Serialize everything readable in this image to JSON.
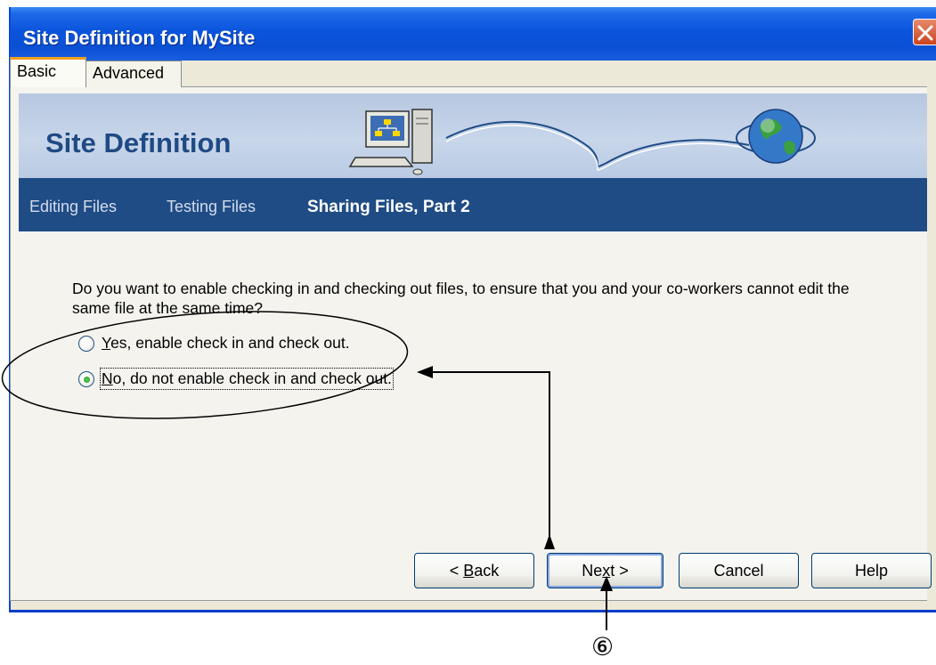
{
  "window": {
    "title": "Site Definition for MySite"
  },
  "tabs": [
    {
      "label": "Basic",
      "selected": true
    },
    {
      "label": "Advanced",
      "selected": false
    }
  ],
  "banner": {
    "title": "Site Definition",
    "icons": [
      "computer-network-icon",
      "globe-icon"
    ]
  },
  "steps": {
    "items": [
      "Editing Files",
      "Testing Files"
    ],
    "current": "Sharing Files, Part 2"
  },
  "content": {
    "question": "Do you want to enable checking in and checking out files, to ensure that you and your co-workers cannot edit the same file at the same time?",
    "options": [
      {
        "mnemonic": "Y",
        "rest": "es, enable check in and check out.",
        "selected": false
      },
      {
        "mnemonic": "N",
        "rest": "o, do not enable check in and check out.",
        "selected": true
      }
    ]
  },
  "buttons": {
    "back": {
      "prefix": "< ",
      "mnemonic": "B",
      "rest": "ack"
    },
    "next": {
      "prefix": "Ne",
      "mnemonic": "x",
      "rest": "t >"
    },
    "cancel": "Cancel",
    "help": "Help"
  },
  "annotation": {
    "callout_number": "⑥"
  },
  "colors": {
    "titlebar": "#0a54dc",
    "banner": "#c0d0e8",
    "navbar": "#1f4c85",
    "banner_title": "#1f4a84",
    "dialog_bg": "#ece9d8"
  }
}
